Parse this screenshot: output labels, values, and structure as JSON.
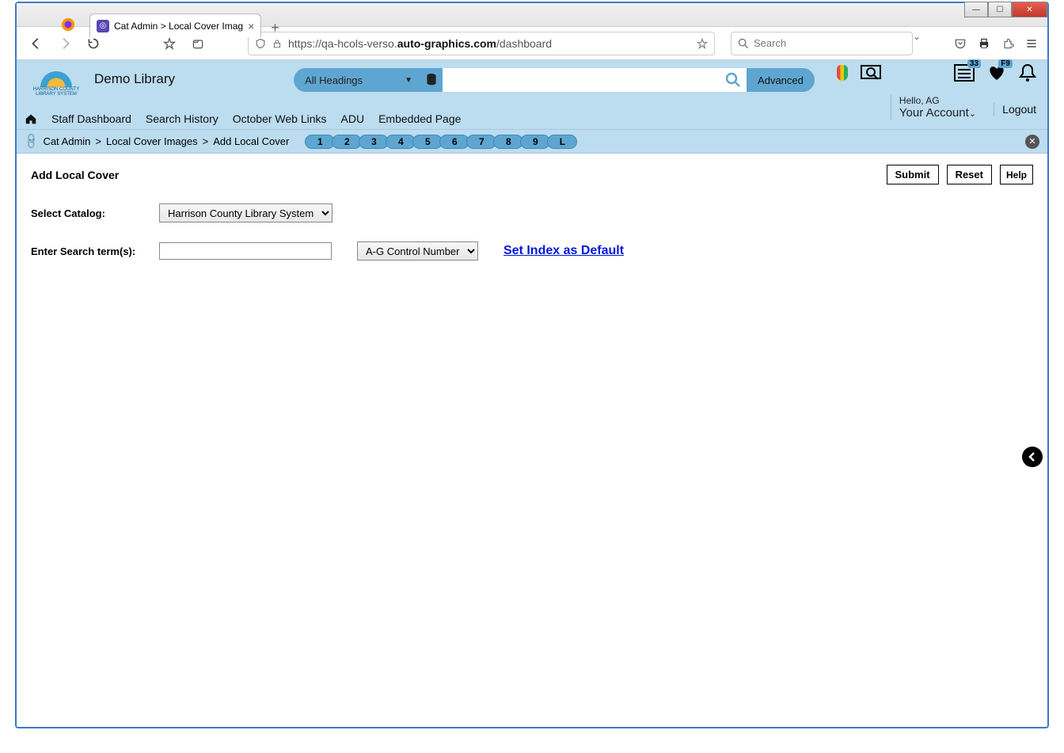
{
  "browser": {
    "tab_title": "Cat Admin > Local Cover Imag",
    "url_display": "https://qa-hcols-verso.",
    "url_bold": "auto-graphics.com",
    "url_tail": "/dashboard",
    "search_placeholder": "Search"
  },
  "header": {
    "library_name": "Demo Library",
    "logo_line1": "HARRISON COUNTY",
    "logo_line2": "LIBRARY SYSTEM",
    "all_headings": "All Headings",
    "advanced": "Advanced",
    "badge_list": "33",
    "badge_heart": "F9",
    "hello": "Hello, AG",
    "account": "Your Account",
    "logout": "Logout"
  },
  "nav": {
    "items": [
      "Staff Dashboard",
      "Search History",
      "October Web Links",
      "ADU",
      "Embedded Page"
    ]
  },
  "breadcrumb": {
    "a": "Cat Admin",
    "b": "Local Cover Images",
    "c": "Add Local Cover",
    "pages": [
      "1",
      "2",
      "3",
      "4",
      "5",
      "6",
      "7",
      "8",
      "9",
      "L"
    ]
  },
  "page": {
    "title": "Add Local Cover",
    "submit": "Submit",
    "reset": "Reset",
    "help": "Help",
    "select_catalog_label": "Select Catalog:",
    "catalog_value": "Harrison County Library System",
    "enter_terms_label": "Enter Search term(s):",
    "index_value": "A-G Control Number",
    "set_default": "Set Index as Default"
  }
}
